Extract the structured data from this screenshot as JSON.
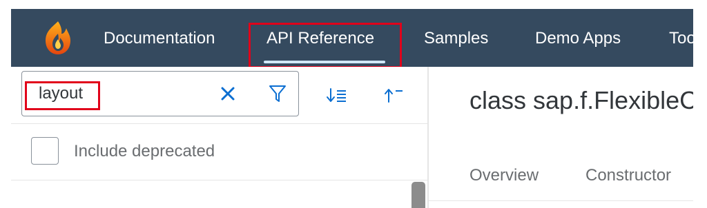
{
  "nav": {
    "logo_icon": "phoenix-flame-logo-icon",
    "items": [
      {
        "label": "Documentation"
      },
      {
        "label": "API Reference",
        "active": true
      },
      {
        "label": "Samples"
      },
      {
        "label": "Demo Apps"
      },
      {
        "label": "Tools"
      }
    ]
  },
  "search": {
    "value": "layout",
    "clear_icon": "close-icon",
    "filter_icon": "filter-icon"
  },
  "toolbar": {
    "sort_icon": "sort-descending-icon",
    "collapse_icon": "collapse-all-icon"
  },
  "filters": {
    "include_deprecated_label": "Include deprecated",
    "include_deprecated_checked": false
  },
  "content": {
    "title": "class sap.f.FlexibleColumnLayout",
    "tabs": [
      {
        "label": "Overview"
      },
      {
        "label": "Constructor"
      }
    ]
  },
  "colors": {
    "nav_background": "#354a5f",
    "highlight": "#e1001a",
    "icon_blue": "#0a6ed1"
  }
}
